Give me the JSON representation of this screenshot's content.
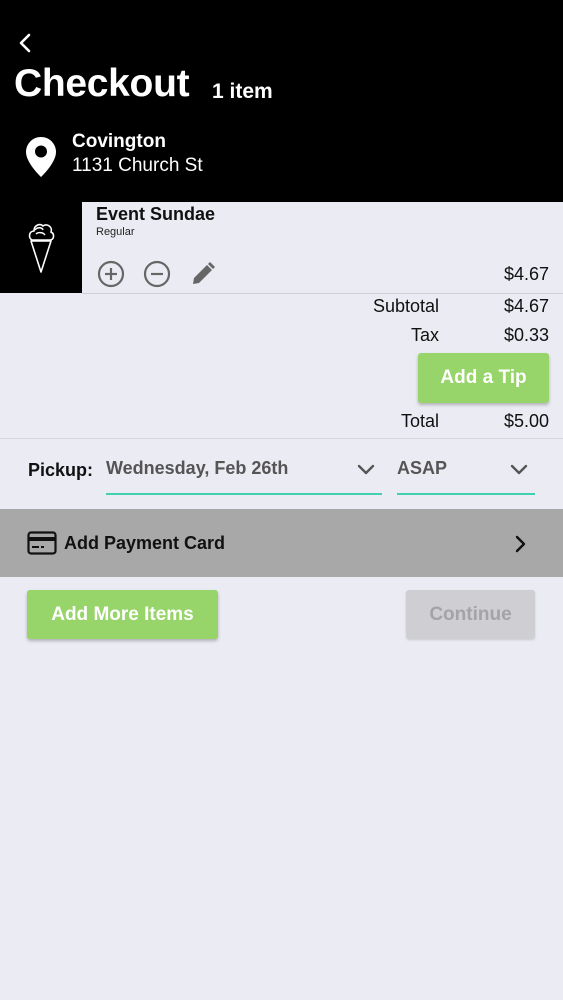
{
  "header": {
    "title": "Checkout",
    "item_count": "1 item",
    "location_name": "Covington",
    "location_address": "1131 Church St"
  },
  "item": {
    "name": "Event Sundae",
    "variant": "Regular",
    "price": "$4.67",
    "icons": [
      "ice-cream-cone-icon",
      "plus-circle-icon",
      "minus-circle-icon",
      "pencil-icon"
    ]
  },
  "summary": {
    "subtotal_label": "Subtotal",
    "subtotal_value": "$4.67",
    "tax_label": "Tax",
    "tax_value": "$0.33",
    "tip_button": "Add a Tip",
    "total_label": "Total",
    "total_value": "$5.00"
  },
  "pickup": {
    "label": "Pickup:",
    "date": "Wednesday, Feb 26th",
    "time": "ASAP"
  },
  "payment": {
    "label": "Add Payment Card"
  },
  "actions": {
    "add_more": "Add More Items",
    "continue": "Continue"
  },
  "colors": {
    "accent_green": "#97d46a",
    "underline_teal": "#3fd1b0",
    "header_bg": "#000000",
    "page_bg": "#ebebf3",
    "payment_bg": "#a8a8a8",
    "disabled_bg": "#cfcfd3"
  }
}
